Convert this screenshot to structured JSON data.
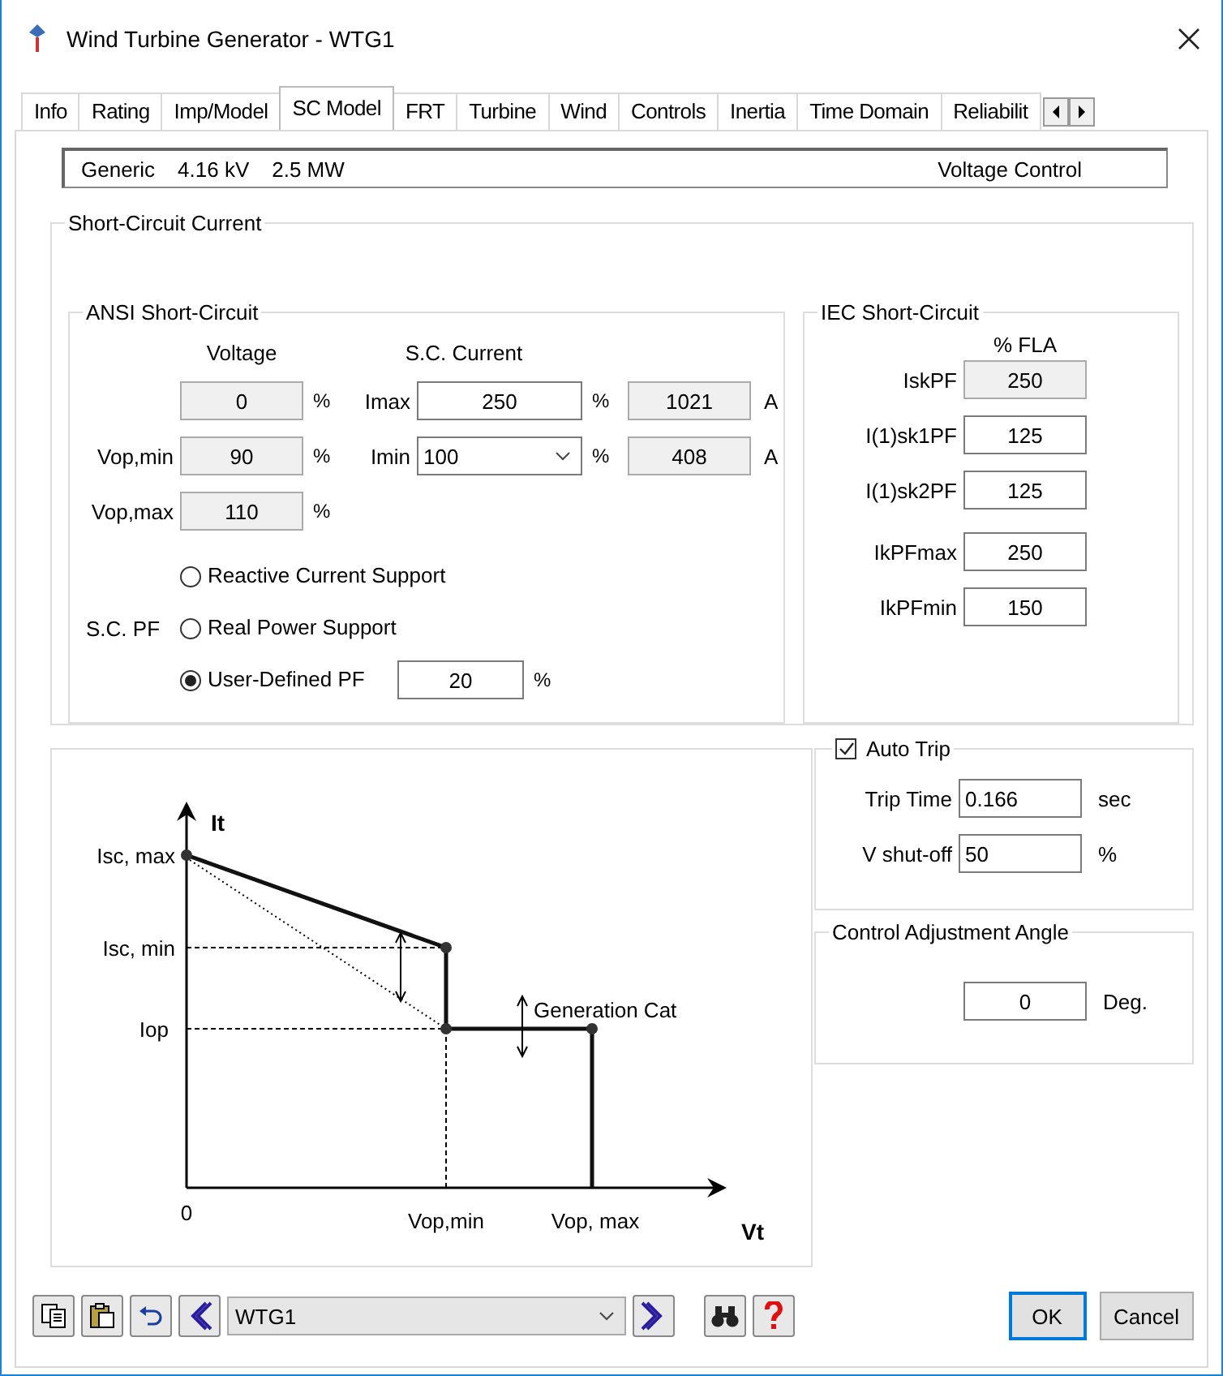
{
  "window": {
    "title": "Wind Turbine Generator - WTG1"
  },
  "tabs": [
    {
      "label": "Info",
      "selected": false
    },
    {
      "label": "Rating",
      "selected": false
    },
    {
      "label": "Imp/Model",
      "selected": false
    },
    {
      "label": "SC Model",
      "selected": true
    },
    {
      "label": "FRT",
      "selected": false
    },
    {
      "label": "Turbine",
      "selected": false
    },
    {
      "label": "Wind",
      "selected": false
    },
    {
      "label": "Controls",
      "selected": false
    },
    {
      "label": "Inertia",
      "selected": false
    },
    {
      "label": "Time Domain",
      "selected": false
    },
    {
      "label": "Reliabilit",
      "selected": false
    }
  ],
  "info_bar": {
    "items": [
      "Generic",
      "4.16 kV",
      "2.5 MW"
    ],
    "right": "Voltage Control"
  },
  "sc_group": {
    "title": "Short-Circuit Current"
  },
  "ansi": {
    "title": "ANSI Short-Circuit",
    "voltage_header": "Voltage",
    "current_header": "S.C. Current",
    "rows": [
      {
        "voltage_label": "",
        "voltage_value": "0",
        "voltage_unit": "%",
        "current": {
          "kind": "input",
          "label": "Imax",
          "value": "250",
          "unit": "%"
        },
        "amps_value": "1021",
        "amps_unit": "A"
      },
      {
        "voltage_label": "Vop,min",
        "voltage_value": "90",
        "voltage_unit": "%",
        "current": {
          "kind": "dropdown",
          "label": "Imin",
          "value": "100",
          "unit": "%"
        },
        "amps_value": "408",
        "amps_unit": "A"
      },
      {
        "voltage_label": "Vop,max",
        "voltage_value": "110",
        "voltage_unit": "%"
      }
    ],
    "pf_label": "S.C. PF",
    "pf_options": [
      {
        "label": "Reactive Current Support",
        "selected": false
      },
      {
        "label": "Real Power Support",
        "selected": false
      },
      {
        "label": "User-Defined PF",
        "selected": true
      }
    ],
    "pf_value": "20",
    "pf_unit": "%"
  },
  "iec": {
    "title": "IEC Short-Circuit",
    "header": "% FLA",
    "rows": [
      {
        "label": "IskPF",
        "value": "250",
        "readonly": true
      },
      {
        "label": "I(1)sk1PF",
        "value": "125",
        "readonly": false
      },
      {
        "label": "I(1)sk2PF",
        "value": "125",
        "readonly": false
      },
      {
        "label": "IkPFmax",
        "value": "250",
        "readonly": false
      },
      {
        "label": "IkPFmin",
        "value": "150",
        "readonly": false
      }
    ]
  },
  "diagram": {
    "y_axis": "It",
    "x_axis": "Vt",
    "y_labels": [
      "Isc, max",
      "Isc, min",
      "Iop"
    ],
    "x_labels": [
      "0",
      "Vop,min",
      "Vop, max"
    ],
    "note": "Generation Cat"
  },
  "auto_trip": {
    "label": "Auto Trip",
    "checked": true,
    "fields": [
      {
        "label": "Trip Time",
        "value": "0.166",
        "unit": "sec"
      },
      {
        "label": "V shut-off",
        "value": "50",
        "unit": "%"
      }
    ]
  },
  "angle": {
    "title": "Control Adjustment Angle",
    "value": "0",
    "unit": "Deg."
  },
  "selector": {
    "value": "WTG1"
  },
  "buttons": [
    {
      "label": "OK",
      "default": true
    },
    {
      "label": "Cancel",
      "default": false
    }
  ]
}
